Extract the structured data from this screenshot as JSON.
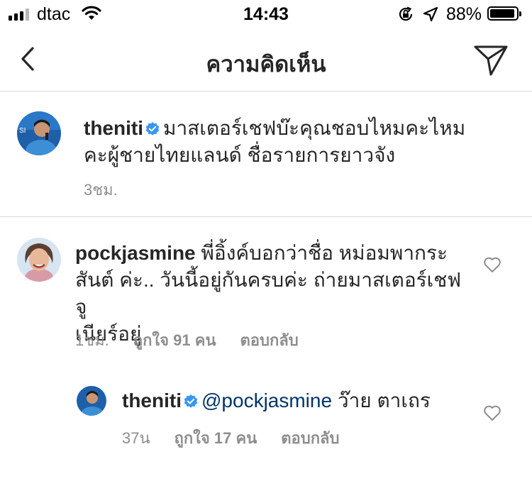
{
  "status_bar": {
    "carrier": "dtac",
    "time": "14:43",
    "battery": "88%",
    "icons": [
      "signal-icon",
      "wifi-icon",
      "orientation-lock-icon",
      "location-icon",
      "battery-icon"
    ]
  },
  "nav": {
    "title": "ความคิดเห็น",
    "icons": [
      "back-chevron-icon",
      "direct-send-icon"
    ]
  },
  "caption": {
    "username": "theniti",
    "verified": true,
    "line1": "มาสเตอร์เชฟบ๊ะคุณชอบไหมคะไหม",
    "line2": "คะผู้ชายไทยแลนด์ ชื่อรายการยาวจัง",
    "time": "3ชม."
  },
  "comments": [
    {
      "username": "pockjasmine",
      "line1": "พี่อิ้งค์บอกว่าชื่อ หม่อมพากระ",
      "line2": "สันต์ ค่ะ.. วันนี้อยู่กันครบค่ะ ถ่ายมาสเตอร์เชฟจู",
      "line3": "เนียร์อยู่",
      "time": "1ชม.",
      "likes": "ถูกใจ 91 คน",
      "reply_label": "ตอบกลับ",
      "replies": [
        {
          "username": "theniti",
          "verified": true,
          "mention": "@pockjasmine",
          "text": "ว๊าย ตาเถร",
          "time": "37น",
          "likes": "ถูกใจ 17 คน",
          "reply_label": "ตอบกลับ"
        }
      ]
    }
  ],
  "colors": {
    "text": "#262626",
    "meta": "#8e8e8e",
    "mention": "#003569",
    "verified": "#3897f0",
    "divider": "#dbdbdb"
  }
}
